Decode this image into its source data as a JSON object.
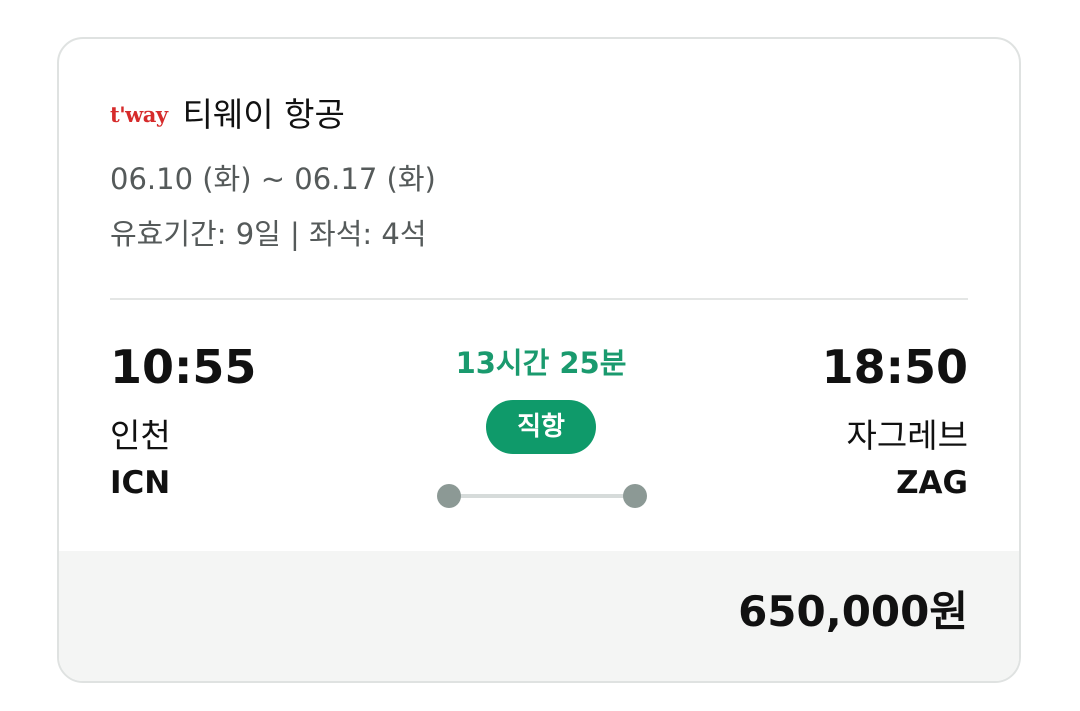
{
  "airline": {
    "logo_text": "t'way",
    "logo_color": "#d62b2b",
    "name": "티웨이 항공"
  },
  "trip": {
    "dates": "06.10 (화) ~ 06.17 (화)",
    "validity": "유효기간: 9일 | 좌석: 4석"
  },
  "departure": {
    "time": "10:55",
    "city": "인천",
    "code": "ICN"
  },
  "arrival": {
    "time": "18:50",
    "city": "자그레브",
    "code": "ZAG"
  },
  "flight": {
    "duration": "13시간 25분",
    "type_label": "직항",
    "accent_color": "#0f9a6a"
  },
  "price": {
    "amount": "650,000원"
  }
}
